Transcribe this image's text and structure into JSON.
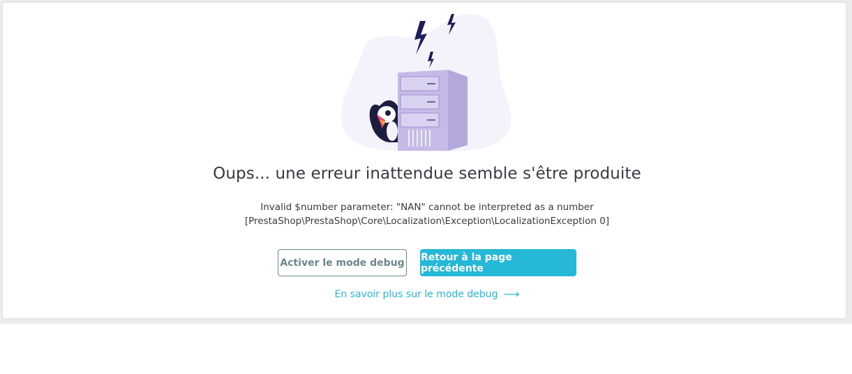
{
  "error": {
    "title": "Oups... une erreur inattendue semble s'être produite",
    "message_line1": "Invalid $number parameter: \"NAN\" cannot be interpreted as a number",
    "message_line2": "[PrestaShop\\PrestaShop\\Core\\Localization\\Exception\\LocalizationException 0]"
  },
  "actions": {
    "debug_label": "Activer le mode debug",
    "back_label": "Retour à la page précédente",
    "learn_more_label": "En savoir plus sur le mode debug"
  },
  "icons": {
    "illustration": "server-error-illustration",
    "arrow": "arrow-right-icon"
  },
  "colors": {
    "primary": "#25b9d7",
    "secondary": "#6c868e",
    "text": "#363a41",
    "server": "#c6bbe8"
  }
}
